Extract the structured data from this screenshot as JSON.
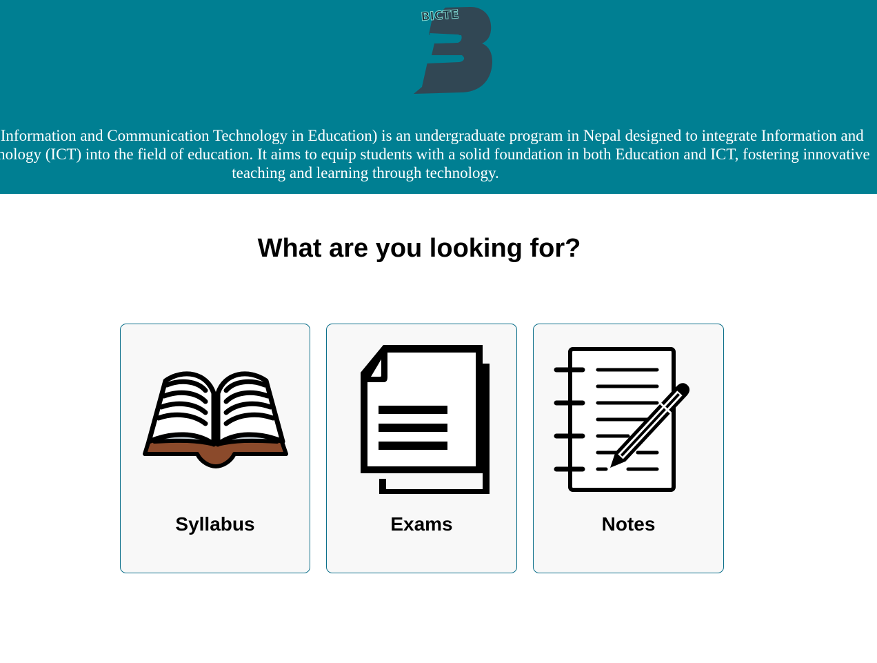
{
  "header": {
    "logo_text": "BICTE",
    "logo_numeral": "3",
    "intro_text": "BICTE (Bachelor of Information and Communication Technology in Education) is an undergraduate program in Nepal designed to integrate Information and Communication Technology (ICT) into the field of education. It aims to equip students with a solid foundation in both Education and ICT, fostering innovative teaching and learning through technology."
  },
  "main": {
    "question": "What are you looking for?",
    "cards": [
      {
        "label": "Syllabus",
        "icon": "open-book-icon"
      },
      {
        "label": "Exams",
        "icon": "document-icon"
      },
      {
        "label": "Notes",
        "icon": "notepad-pen-icon"
      }
    ]
  },
  "colors": {
    "header_background": "#007f92",
    "card_border": "#0b6f8a",
    "card_background": "#f8f8f8",
    "book_cover": "#8b4a2b"
  }
}
